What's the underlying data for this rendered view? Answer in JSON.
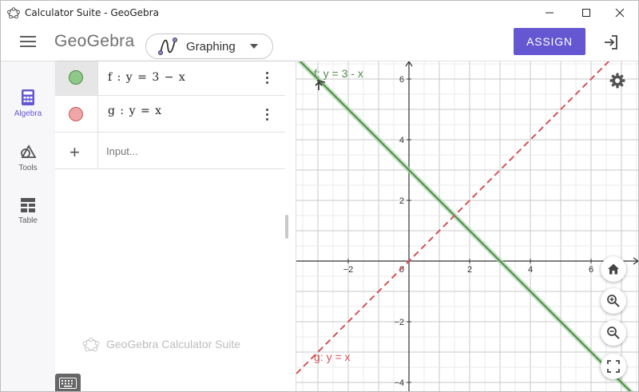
{
  "window": {
    "title": "Calculator Suite - GeoGebra",
    "controls": [
      "minimize",
      "maximize",
      "close"
    ]
  },
  "header": {
    "logo": "GeoGebra",
    "app_picker_label": "Graphing",
    "assign_label": "ASSIGN"
  },
  "rail": {
    "items": [
      {
        "label": "Algebra",
        "icon": "calculator-icon",
        "active": true
      },
      {
        "label": "Tools",
        "icon": "shapes-icon",
        "active": false
      },
      {
        "label": "Table",
        "icon": "table-icon",
        "active": false
      }
    ]
  },
  "algebra": {
    "rows": [
      {
        "expression": "f : y = 3 − x",
        "color": "#6faa6a",
        "selected": true
      },
      {
        "expression": "g : y = x",
        "color": "#e0888c",
        "selected": false
      }
    ],
    "input_placeholder": "Input...",
    "brand": "GeoGebra Calculator Suite"
  },
  "graph": {
    "x_ticks": [
      "−2",
      "0",
      "2",
      "4",
      "6"
    ],
    "y_ticks": [
      "6",
      "4",
      "2",
      "−2",
      "−4"
    ],
    "origin_label": "0",
    "functions": [
      {
        "name": "f",
        "label": "f: y = 3 - x",
        "slope": -1,
        "intercept": 3,
        "color": "#4f8a4a",
        "style": "solid"
      },
      {
        "name": "g",
        "label": "g: y = x",
        "slope": 1,
        "intercept": 0,
        "color": "#d25459",
        "style": "dashed"
      }
    ],
    "buttons": [
      "home-icon",
      "zoom-in-icon",
      "zoom-out-icon",
      "fullscreen-icon"
    ]
  },
  "colors": {
    "accent": "#6557d2",
    "grid_major": "#c8c8c8",
    "grid_minor": "#ebebeb"
  }
}
